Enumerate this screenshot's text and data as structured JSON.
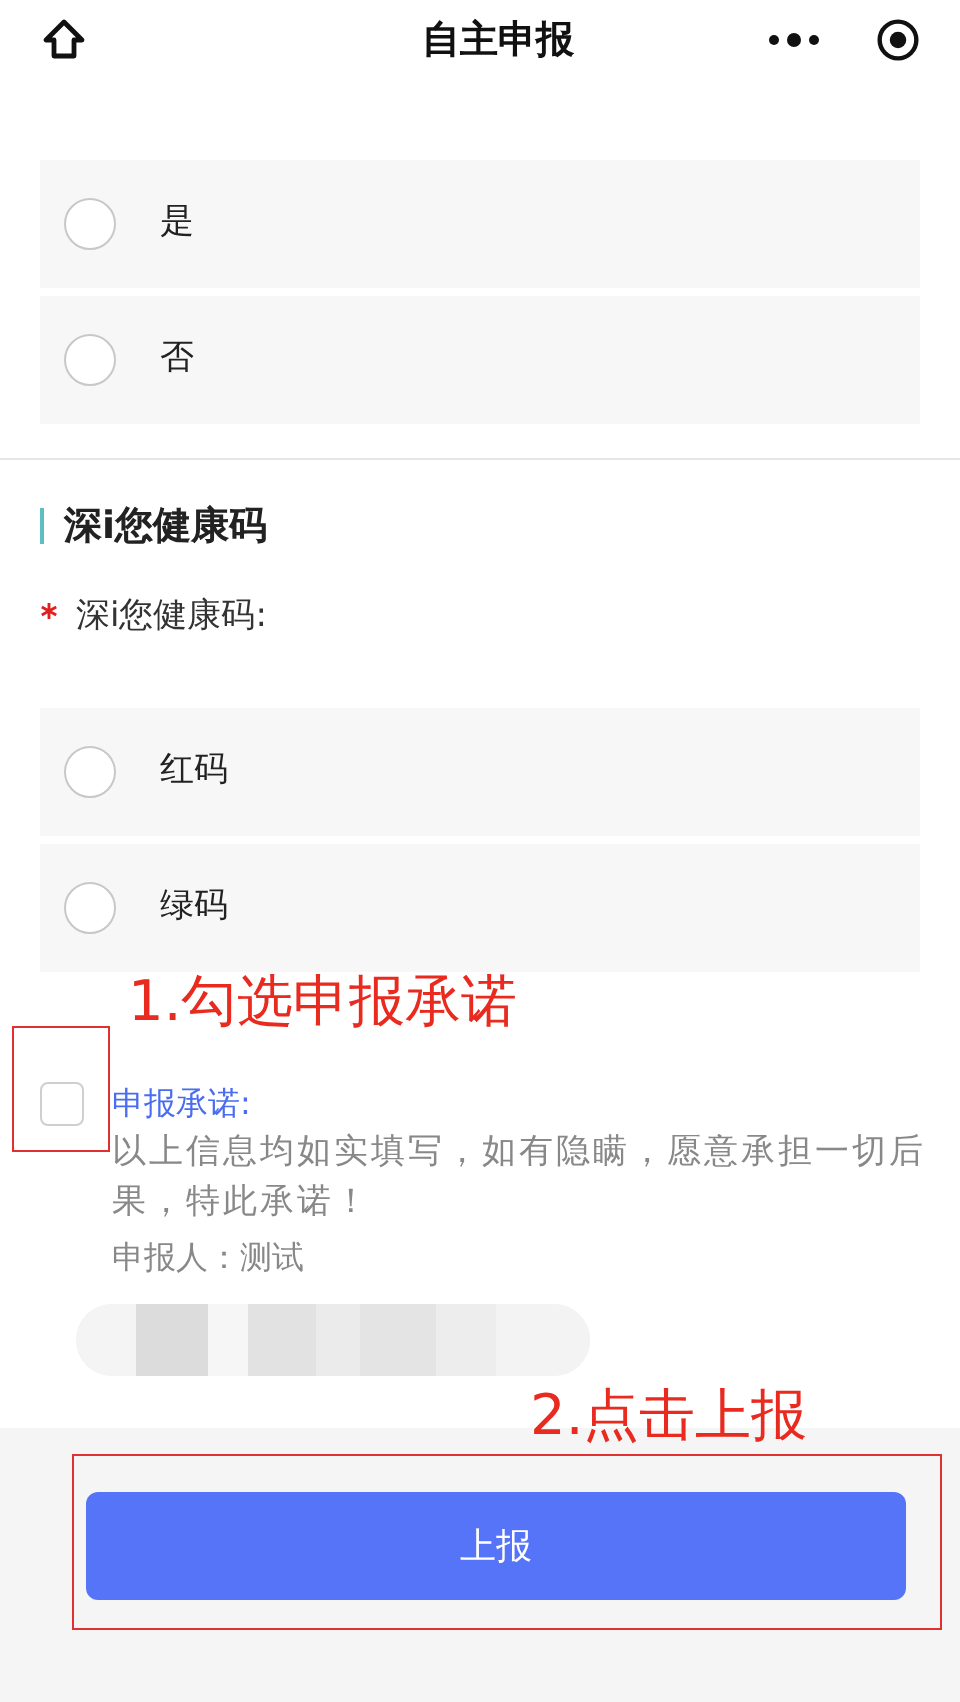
{
  "header": {
    "title": "自主申报"
  },
  "question_1": {
    "options": [
      {
        "label": "是",
        "selected": false
      },
      {
        "label": "否",
        "selected": false
      }
    ]
  },
  "section": {
    "title": "深i您健康码",
    "field_label": "深i您健康码:",
    "required": true,
    "options": [
      {
        "label": "红码",
        "selected": false
      },
      {
        "label": "绿码",
        "selected": false
      }
    ]
  },
  "pledge": {
    "checked": false,
    "title": "申报承诺:",
    "text": "以上信息均如实填写，如有隐瞒，愿意承担一切后果，特此承诺！",
    "signer": "申报人：测试"
  },
  "annotations": [
    {
      "text": "1.勾选申报承诺"
    },
    {
      "text": "2.点击上报"
    }
  ],
  "submit_button": {
    "label": "上报"
  }
}
